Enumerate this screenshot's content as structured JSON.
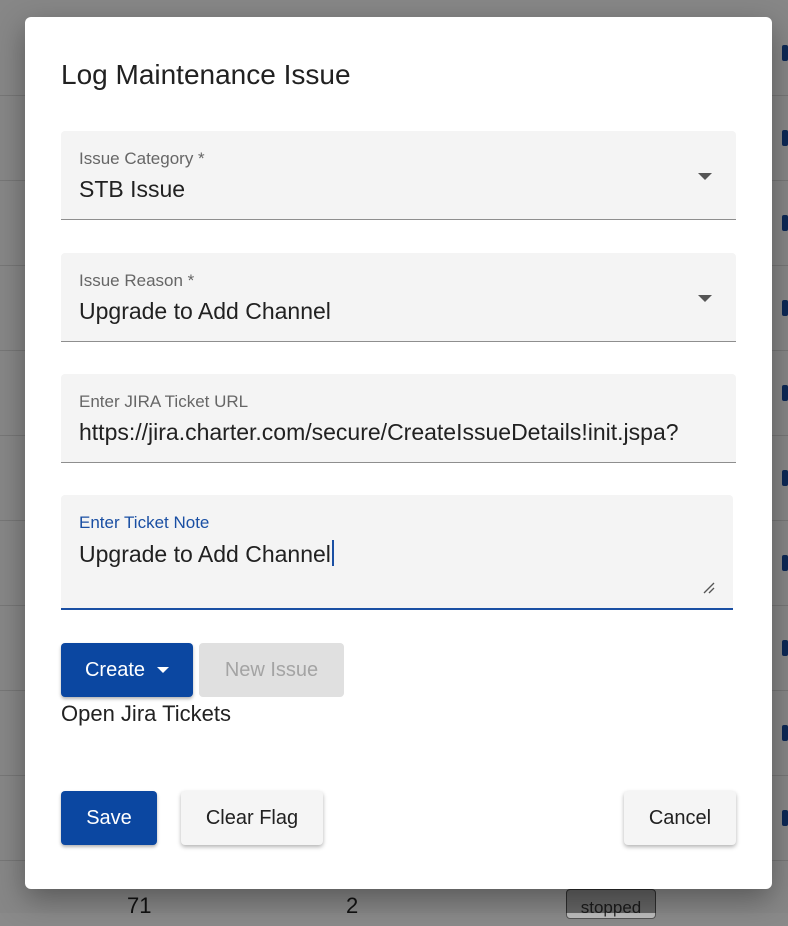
{
  "dialog": {
    "title": "Log Maintenance Issue",
    "fields": {
      "issue_category": {
        "label": "Issue Category *",
        "value": "STB Issue"
      },
      "issue_reason": {
        "label": "Issue Reason *",
        "value": "Upgrade to Add Channel"
      },
      "jira_url": {
        "label": "Enter JIRA Ticket URL",
        "value": "https://jira.charter.com/secure/CreateIssueDetails!init.jspa?"
      },
      "ticket_note": {
        "label": "Enter Ticket Note",
        "value": "Upgrade to Add Channel"
      }
    },
    "create_button": "Create",
    "new_issue_button": "New Issue",
    "open_jira_tickets": "Open Jira Tickets",
    "save_button": "Save",
    "clear_flag_button": "Clear Flag",
    "cancel_button": "Cancel"
  },
  "background": {
    "row_cells": [
      "71",
      "2"
    ],
    "status_badge": "stopped"
  },
  "colors": {
    "accent": "#0b47a1",
    "focus": "#1a4fa3"
  }
}
